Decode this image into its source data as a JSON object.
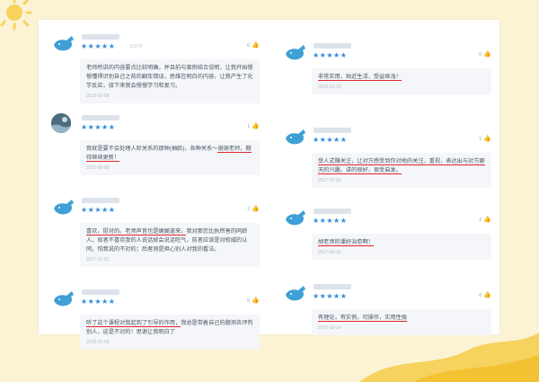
{
  "theme": {
    "accent": "#2f8be0",
    "highlight": "#e0242a",
    "background": "#fbf3d4",
    "bubble": "#f4f6f9"
  },
  "reviews_left": [
    {
      "avatar_icon": "whale-icon",
      "stars": "★★★★★",
      "meta": "5.0 分",
      "likes": "0",
      "pre": "老师所讲的内容要点比较明确，并且前与案例结合说明，让我开始慢慢懂得识别自己之前的翻车错误，思维在明白的内容，让我产生了化学反应，接下来我会慢慢学习和复习。",
      "mark": "",
      "post": "",
      "date": "2018-02-08"
    },
    {
      "avatar_icon": "ocean-avatar-icon",
      "stars": "★★★★★",
      "meta": "",
      "likes": "1",
      "pre": "我就是要不会处理人际关系的那种(抽脸)，各种关系～",
      "mark": "谢谢老师，期待继续更新！",
      "post": "",
      "date": "2017-08-02"
    },
    {
      "avatar_icon": "whale-icon",
      "stars": "★★★★★",
      "meta": "",
      "likes": "2",
      "pre": "",
      "mark": "喜欢，挺对的。老师声音也是娓娓道来，",
      "post": "我对那您比执所害的同龄人，就者不喜欢我的人说话就会说话吃气，前者应该是对权威的认同，怕我说的不对的；后者则是担心别人对我的看法。",
      "date": "2017-11-25"
    },
    {
      "avatar_icon": "whale-icon",
      "stars": "★★★★★",
      "meta": "",
      "likes": "0",
      "pre": "",
      "mark": "听了这个课程对我起到了引导的作用，",
      "post": "我总是带着自己的臆测去评判别人，这是不对的！思谢让我明白了",
      "date": "2018-01-09"
    }
  ],
  "reviews_right": [
    {
      "avatar_icon": "whale-icon",
      "stars": "★★★★★",
      "meta": "",
      "likes": "0",
      "pre": "",
      "mark": "非常实用，贴近生活，受益匪浅！",
      "post": "",
      "date": "2018-02-19"
    },
    {
      "avatar_icon": "whale-icon",
      "stars": "★★★★★",
      "meta": "",
      "likes": "1",
      "pre": "",
      "mark": "受人式赚关注，让对方感受到你对他的关注，重视，表达出与对方聊天的兴趣。讲的很好，很受启发。",
      "post": "",
      "date": "2017-07-05"
    },
    {
      "avatar_icon": "whale-icon",
      "stars": "★★★★★",
      "meta": "",
      "likes": "2",
      "pre": "",
      "mark": "胡老师的课好治愈啊！",
      "post": "",
      "date": "2017-06-15"
    },
    {
      "avatar_icon": "whale-icon",
      "stars": "★★★★★",
      "meta": "",
      "likes": "0",
      "pre": "",
      "mark": "有理论，有实例，可操作，实用性强",
      "post": "",
      "date": "2017-10-14"
    }
  ]
}
